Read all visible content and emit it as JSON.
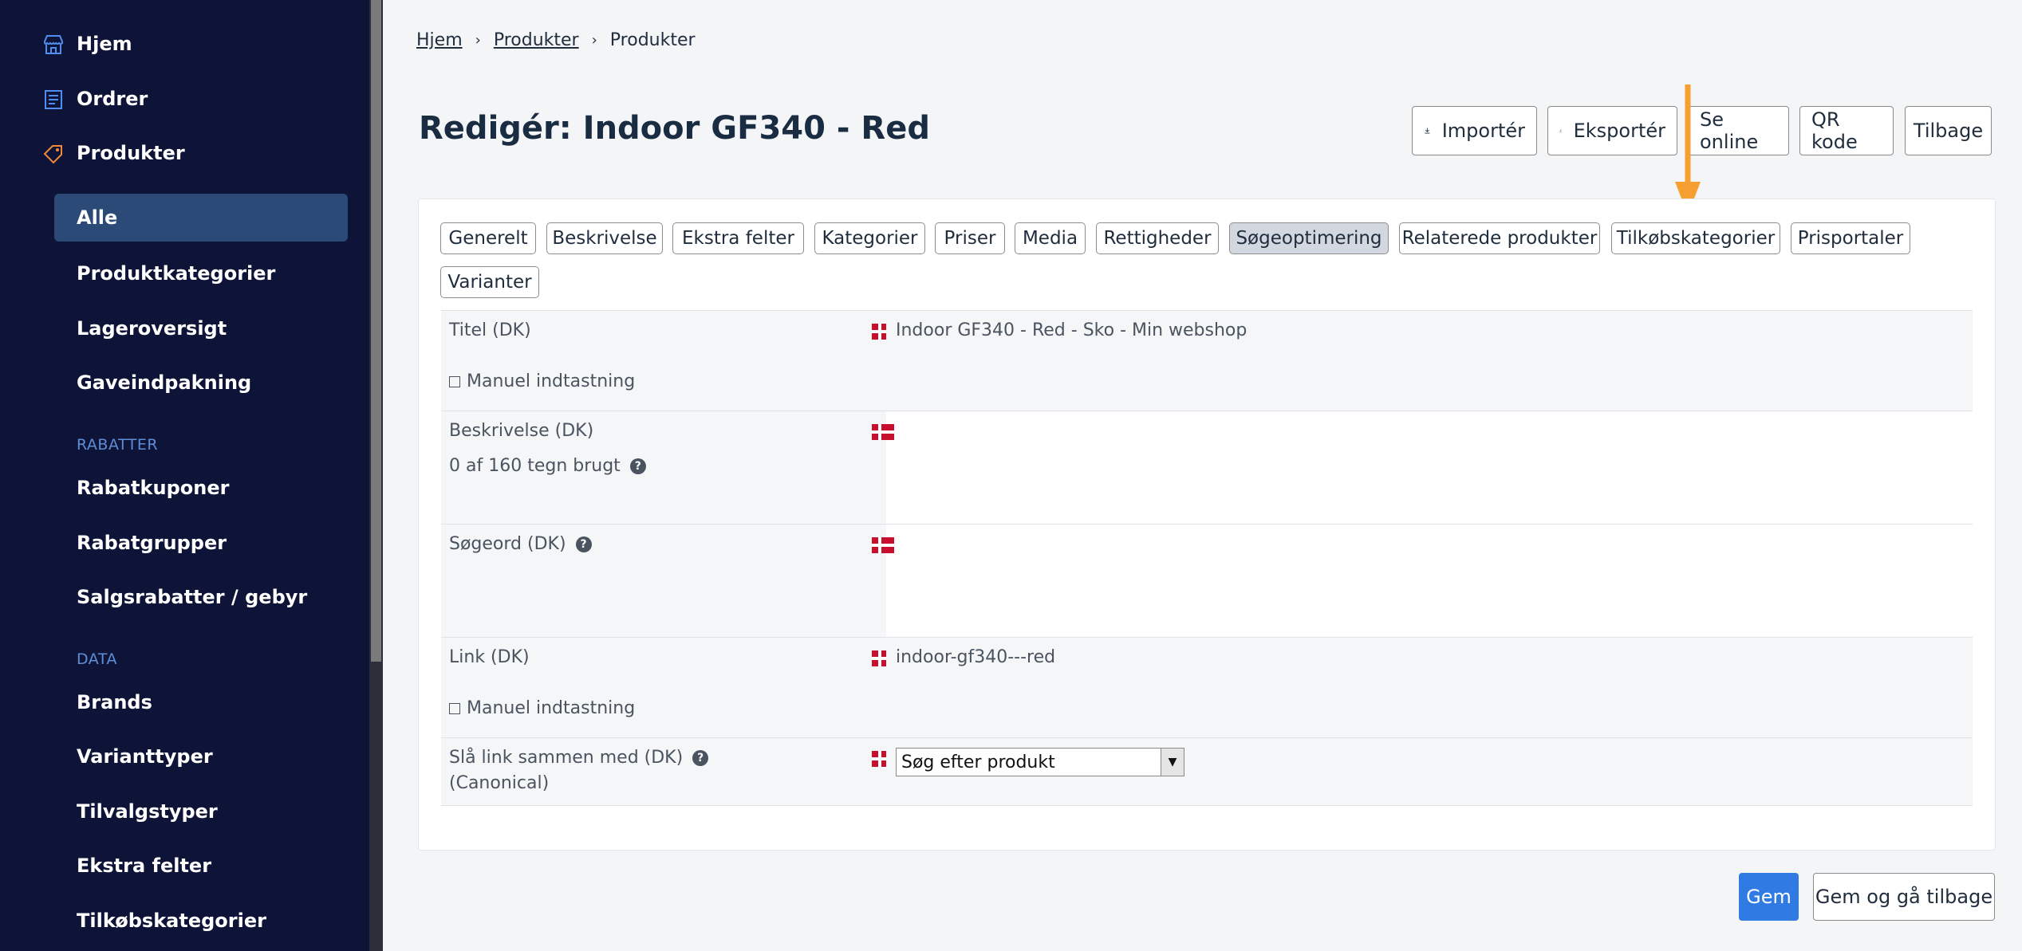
{
  "sidebar": {
    "top_items": [
      {
        "label": "Hjem",
        "icon": "store-icon"
      },
      {
        "label": "Ordrer",
        "icon": "receipt-icon"
      },
      {
        "label": "Produkter",
        "icon": "tag-icon"
      }
    ],
    "product_sub_items": [
      {
        "label": "Alle",
        "active": true
      },
      {
        "label": "Produktkategorier"
      },
      {
        "label": "Lageroversigt"
      },
      {
        "label": "Gaveindpakning"
      }
    ],
    "section_rabatter": "RABATTER",
    "rabatter_items": [
      {
        "label": "Rabatkuponer"
      },
      {
        "label": "Rabatgrupper"
      },
      {
        "label": "Salgsrabatter / gebyr"
      }
    ],
    "section_data": "DATA",
    "data_items": [
      {
        "label": "Brands"
      },
      {
        "label": "Varianttyper"
      },
      {
        "label": "Tilvalgstyper"
      },
      {
        "label": "Ekstra felter"
      },
      {
        "label": "Tilkøbskategorier"
      }
    ]
  },
  "breadcrumb": [
    "Hjem",
    "Produkter",
    "Produkter"
  ],
  "page_title": "Redigér: Indoor GF340 - Red",
  "top_buttons": [
    {
      "label": "Importér",
      "icon": "download-icon"
    },
    {
      "label": "Eksportér",
      "icon": "upload-icon"
    },
    {
      "label": "Se online"
    },
    {
      "label": "QR kode"
    },
    {
      "label": "Tilbage"
    }
  ],
  "tabs": [
    {
      "label": "Generelt"
    },
    {
      "label": "Beskrivelse"
    },
    {
      "label": "Ekstra felter"
    },
    {
      "label": "Kategorier"
    },
    {
      "label": "Priser"
    },
    {
      "label": "Media"
    },
    {
      "label": "Rettigheder"
    },
    {
      "label": "Søgeoptimering",
      "active": true
    },
    {
      "label": "Relaterede produkter"
    },
    {
      "label": "Tilkøbskategorier"
    },
    {
      "label": "Prisportaler"
    },
    {
      "label": "Varianter"
    }
  ],
  "form": {
    "title_label": "Titel (DK)",
    "title_value": "Indoor GF340 - Red - Sko - Min webshop",
    "manual_entry": "Manuel indtastning",
    "description_label": "Beskrivelse (DK)",
    "description_counter": "0 af 160 tegn brugt",
    "keywords_label": "Søgeord (DK)",
    "link_label": "Link (DK)",
    "link_value": "indoor-gf340---red",
    "canonical_label": "Slå link sammen med (DK)",
    "canonical_sub": "(Canonical)",
    "canonical_select": "Søg efter produkt"
  },
  "actions": {
    "save": "Gem",
    "save_back": "Gem og gå tilbage"
  },
  "colors": {
    "sidebar_bg": "#0e1437",
    "active_item": "#2b4a78",
    "primary": "#2f7be3",
    "annotation_arrow": "#f5a030"
  }
}
